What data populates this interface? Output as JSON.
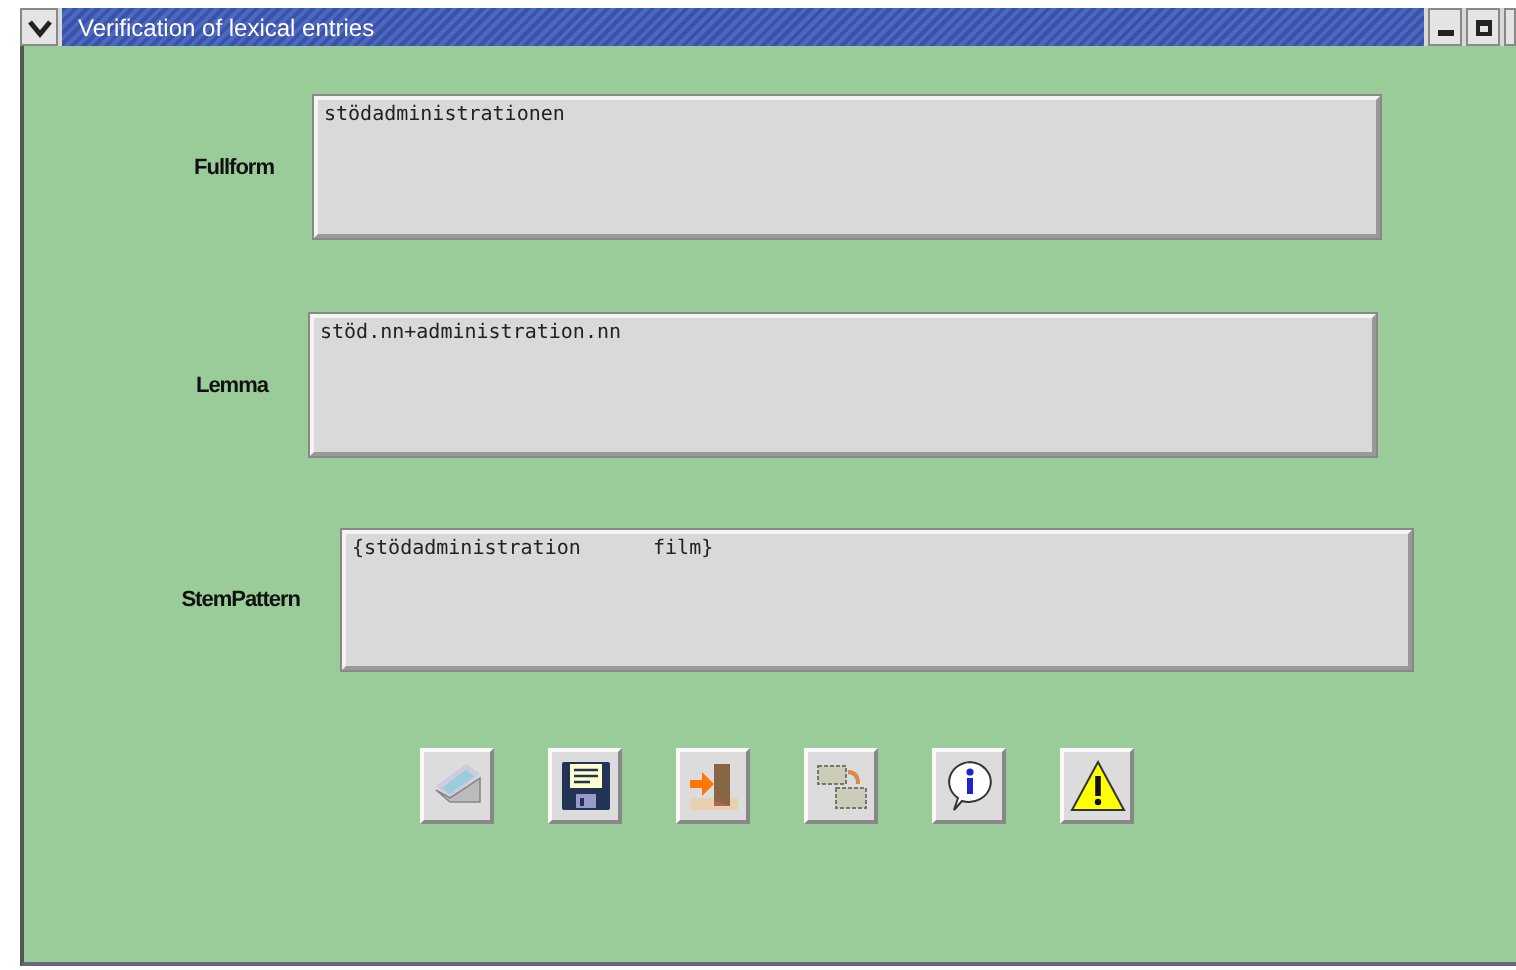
{
  "window": {
    "title": "Verification of lexical entries"
  },
  "fields": [
    {
      "label": "Fullform",
      "value": "stödadministrationen"
    },
    {
      "label": "Lemma",
      "value": "stöd.nn+administration.nn"
    },
    {
      "label": "StemPattern",
      "value": "{stödadministration      film}"
    }
  ],
  "toolbar": [
    {
      "kind": "scanner"
    },
    {
      "kind": "save"
    },
    {
      "kind": "exit"
    },
    {
      "kind": "copy"
    },
    {
      "kind": "info"
    },
    {
      "kind": "warning"
    }
  ]
}
